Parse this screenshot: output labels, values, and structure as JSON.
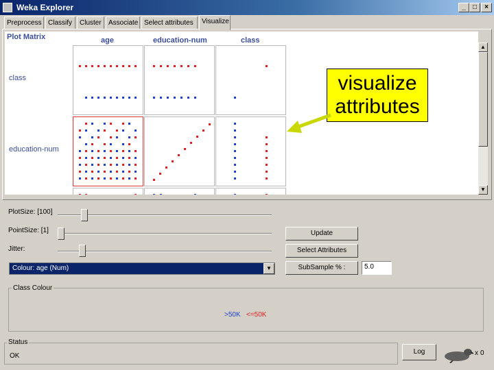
{
  "window": {
    "title": "Weka Explorer",
    "minimize": "_",
    "maximize": "□",
    "close": "×"
  },
  "tabs": [
    {
      "label": "Preprocess"
    },
    {
      "label": "Classify"
    },
    {
      "label": "Cluster"
    },
    {
      "label": "Associate"
    },
    {
      "label": "Select attributes"
    },
    {
      "label": "Visualize",
      "active": true
    }
  ],
  "plot": {
    "title": "Plot Matrix",
    "columns": [
      "age",
      "education-num",
      "class"
    ],
    "rows": [
      "class",
      "education-num"
    ]
  },
  "controls": {
    "plotsize_label": "PlotSize: [100]",
    "plotsize_value": 100,
    "pointsize_label": "PointSize: [1]",
    "pointsize_value": 1,
    "jitter_label": "Jitter:",
    "update_button": "Update",
    "select_attributes_button": "Select Attributes",
    "colour_select": "Colour: age (Num)",
    "subsample_button": "SubSample % :",
    "subsample_value": "5.0"
  },
  "class_colour": {
    "title": "Class Colour",
    "entries": [
      {
        "label": ">50K",
        "color": "#2040d0"
      },
      {
        "label": "<=50K",
        "color": "#e02020"
      }
    ]
  },
  "status": {
    "title": "Status",
    "text": "OK",
    "log_button": "Log",
    "count": "0"
  },
  "callout": {
    "line1": "visualize",
    "line2": "attributes"
  },
  "colors": {
    "accent": "#0a246a",
    "label_blue": "#3a4e9a",
    "callout": "#ffff00",
    "arrow": "#c8d800"
  }
}
